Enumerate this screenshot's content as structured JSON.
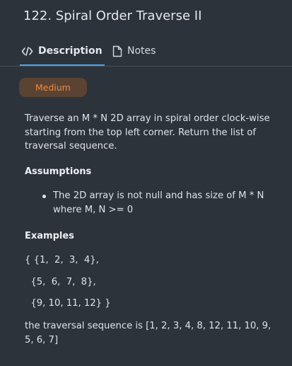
{
  "problem": {
    "title": "122. Spiral Order Traverse II",
    "difficulty": "Medium"
  },
  "tabs": [
    {
      "label": "Description",
      "active": true,
      "icon": "code-icon"
    },
    {
      "label": "Notes",
      "active": false,
      "icon": "file-icon"
    }
  ],
  "description": {
    "intro": "Traverse an M * N 2D array in spiral order clock-wise starting from the top left corner. Return the list of traversal sequence.",
    "assumptions_heading": "Assumptions",
    "assumptions": [
      "The 2D array is not null and has size of M * N where M, N >= 0"
    ],
    "examples_heading": "Examples",
    "example_lines": [
      "{ {1,  2,  3,  4},",
      "  {5,  6,  7,  8},",
      "  {9, 10, 11, 12} }"
    ],
    "example_result": "the traversal sequence is [1, 2, 3, 4, 8, 12, 11, 10, 9, 5, 6, 7]"
  },
  "colors": {
    "background": "#2c333b",
    "accent": "#4da3e8",
    "badge_text": "#f08a3e",
    "badge_bg": "#5a4333"
  }
}
